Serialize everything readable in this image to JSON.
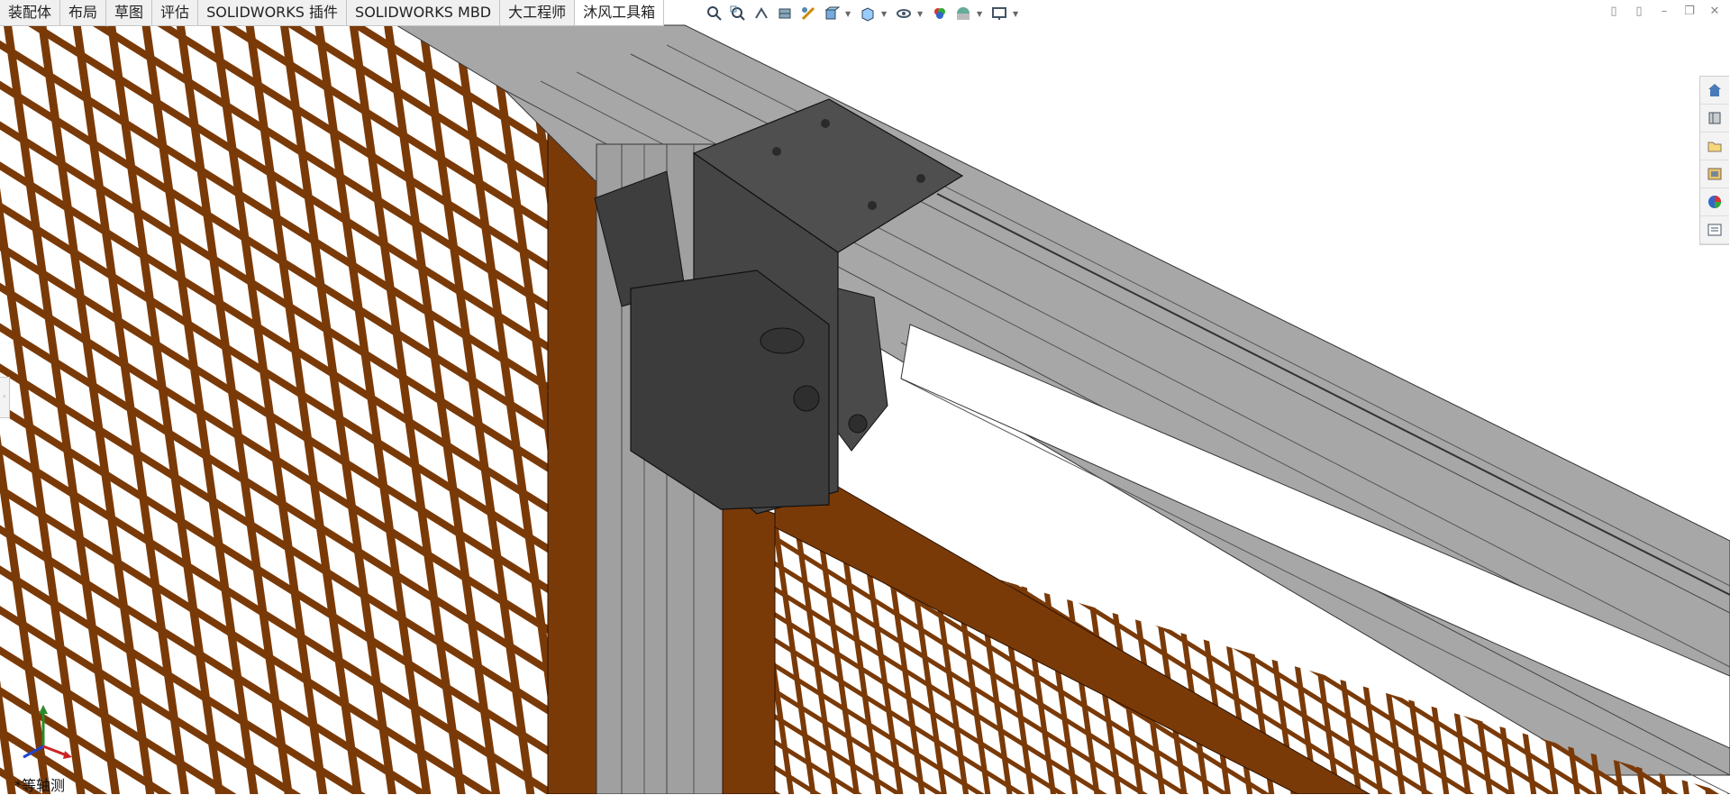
{
  "tabs": [
    "装配体",
    "布局",
    "草图",
    "评估",
    "SOLIDWORKS 插件",
    "SOLIDWORKS MBD",
    "大工程师",
    "沐风工具箱"
  ],
  "active_tab": "沐风工具箱",
  "view_toolbar": {
    "icons": [
      "zoom-to-fit-icon",
      "zoom-to-area-icon",
      "previous-view-icon",
      "section-view-icon",
      "dynamic-annotation-icon",
      "view-orientation-icon",
      "display-style-icon",
      "hide-show-items-icon",
      "edit-appearance-icon",
      "apply-scene-icon",
      "view-settings-icon"
    ]
  },
  "window_controls": [
    "tile-left-icon",
    "tile-right-icon",
    "minimize-icon",
    "restore-icon",
    "close-icon"
  ],
  "task_pane": {
    "icons": [
      "solidworks-resources-icon",
      "design-library-icon",
      "file-explorer-icon",
      "view-palette-icon",
      "appearances-scenes-icon",
      "custom-properties-icon"
    ]
  },
  "viewport": {
    "view_orientation": "*等轴测"
  },
  "colors": {
    "frame_brown": "#7a3a08",
    "aluminum": "#a9a9a9",
    "bracket_dark": "#474747",
    "background": "#ffffff"
  }
}
